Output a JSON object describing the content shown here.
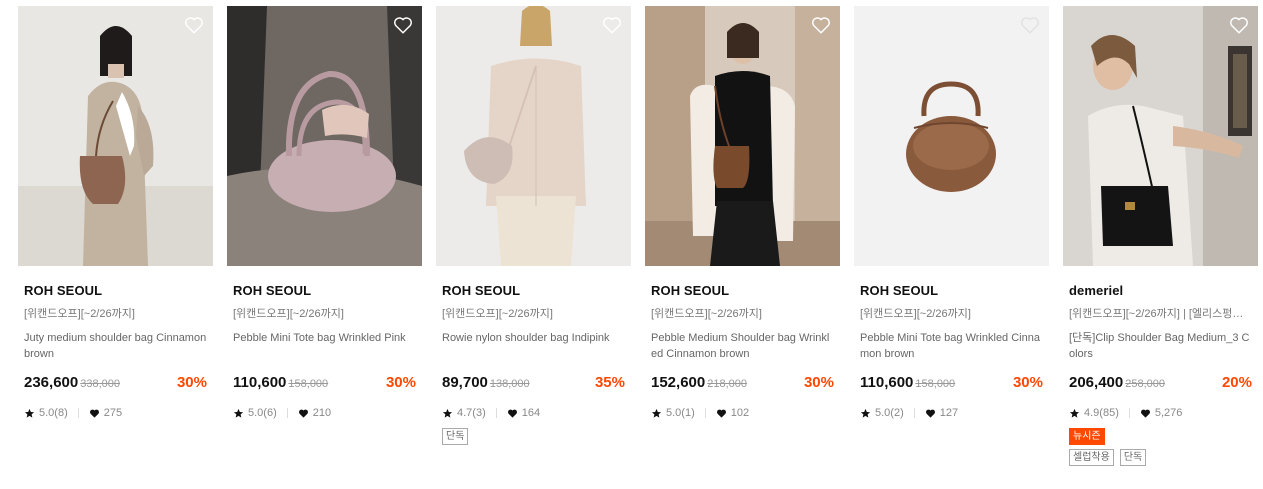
{
  "colors": {
    "discount": "#ff4800",
    "new_badge_bg": "#ff4800",
    "text_muted": "#888888"
  },
  "icons": {
    "wishlist": "heart-outline-icon",
    "rating": "star-icon",
    "likes": "heart-icon"
  },
  "products": [
    {
      "brand": "ROH SEOUL",
      "promo": "[위캔드오프][~2/26까지]",
      "name": "Juty medium shoulder bag Cinnamon brown",
      "price": "236,600",
      "original_price": "338,000",
      "discount": "30%",
      "rating": "5.0(8)",
      "likes": "275",
      "tags": []
    },
    {
      "brand": "ROH SEOUL",
      "promo": "[위캔드오프][~2/26까지]",
      "name": "Pebble Mini Tote bag Wrinkled Pink",
      "price": "110,600",
      "original_price": "158,000",
      "discount": "30%",
      "rating": "5.0(6)",
      "likes": "210",
      "tags": []
    },
    {
      "brand": "ROH SEOUL",
      "promo": "[위캔드오프][~2/26까지]",
      "name": "Rowie nylon shoulder bag Indipink",
      "price": "89,700",
      "original_price": "138,000",
      "discount": "35%",
      "rating": "4.7(3)",
      "likes": "164",
      "tags": [
        "단독"
      ]
    },
    {
      "brand": "ROH SEOUL",
      "promo": "[위캔드오프][~2/26까지]",
      "name": "Pebble Medium Shoulder bag Wrinkled Cinnamon brown",
      "price": "152,600",
      "original_price": "218,000",
      "discount": "30%",
      "rating": "5.0(1)",
      "likes": "102",
      "tags": []
    },
    {
      "brand": "ROH SEOUL",
      "promo": "[위캔드오프][~2/26까지]",
      "name": "Pebble Mini Tote bag Wrinkled Cinnamon brown",
      "price": "110,600",
      "original_price": "158,000",
      "discount": "30%",
      "rating": "5.0(2)",
      "likes": "127",
      "tags": []
    },
    {
      "brand": "demeriel",
      "promo": "[위캔드오프][~2/26까지] | [엘리스펑…",
      "name": "[단독]Clip Shoulder Bag Medium_3 Colors",
      "price": "206,400",
      "original_price": "258,000",
      "discount": "20%",
      "rating": "4.9(85)",
      "likes": "5,276",
      "new_badge": "뉴시즌",
      "tags": [
        "셀럽착용",
        "단독"
      ]
    }
  ]
}
